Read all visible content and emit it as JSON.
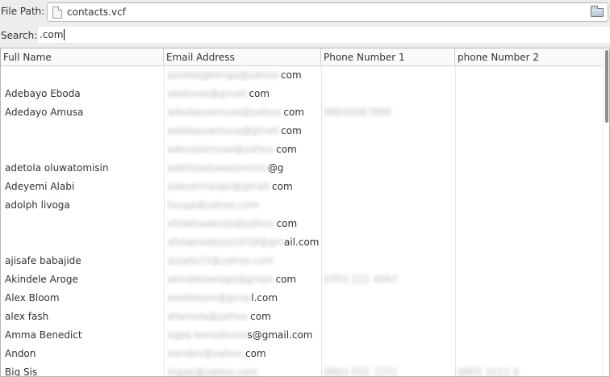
{
  "file_path": {
    "label": "File Path:",
    "value": "contacts.vcf"
  },
  "search": {
    "label": "Search:",
    "value": ".com"
  },
  "table": {
    "columns": [
      "Full Name",
      "Email Address",
      "Phone Number 1",
      "phone Number 2"
    ],
    "rows": [
      {
        "name": "",
        "email_hidden": "ayodejigbenga@yahoo.",
        "email_visible": "com",
        "phone1": "",
        "phone2": ""
      },
      {
        "name": "Adebayo Eboda",
        "email_hidden": "abeboda@gmail.",
        "email_visible": "com",
        "phone1": "",
        "phone2": ""
      },
      {
        "name": "Adedayo Amusa",
        "email_hidden": "adedayoamusa@yahoo.",
        "email_visible": "com",
        "phone1": "08034567890",
        "phone2": ""
      },
      {
        "name": "",
        "email_hidden": "adedayoamusa@gmail.",
        "email_visible": "com",
        "phone1": "",
        "phone2": ""
      },
      {
        "name": "",
        "email_hidden": "adesojiamusa@yahoo.",
        "email_visible": "com",
        "phone1": "",
        "phone2": ""
      },
      {
        "name": "adetola oluwatomisin",
        "email_hidden": "adetolaoluwatomisin",
        "email_visible": "@g",
        "phone1": "",
        "phone2": ""
      },
      {
        "name": "Adeyemi Alabi",
        "email_hidden": "adeyemialabi@gmail.",
        "email_visible": "com",
        "phone1": "",
        "phone2": ""
      },
      {
        "name": "adolph livoga",
        "email_hidden": "livoga@yahoo.com",
        "email_visible": "",
        "phone1": "",
        "phone2": ""
      },
      {
        "name": "",
        "email_hidden": "afolabiadesoji@yahoo.",
        "email_visible": "com",
        "phone1": "",
        "phone2": ""
      },
      {
        "name": "",
        "email_hidden": "afolabiadesoji2018@gm",
        "email_visible": "ail.com",
        "phone1": "",
        "phone2": ""
      },
      {
        "name": "ajisafe babajide",
        "email_hidden": "ajisafe23@yahoo.com",
        "email_visible": "",
        "phone1": "",
        "phone2": ""
      },
      {
        "name": "Akindele Aroge",
        "email_hidden": "akindelearoge@gmail.",
        "email_visible": "com",
        "phone1": "0703 222 4567",
        "phone2": ""
      },
      {
        "name": "Alex Bloom",
        "email_hidden": "alexbloom@gmai",
        "email_visible": "l.com",
        "phone1": "",
        "phone2": ""
      },
      {
        "name": "alex fash",
        "email_hidden": "afashola@yahoo.",
        "email_visible": "com",
        "phone1": "",
        "phone2": ""
      },
      {
        "name": "Amma Benedict",
        "email_hidden": "kgpq benedictos",
        "email_visible": "s@gmail.com",
        "phone1": "",
        "phone2": ""
      },
      {
        "name": "Andon",
        "email_hidden": "bandev@yahoo.",
        "email_visible": "com",
        "phone1": "",
        "phone2": ""
      },
      {
        "name": "Big Sis",
        "email_hidden": "bigsis@yahoo.com",
        "email_visible": "",
        "phone1": "0803 555 7271",
        "phone2": "0805 2221 6"
      }
    ]
  }
}
